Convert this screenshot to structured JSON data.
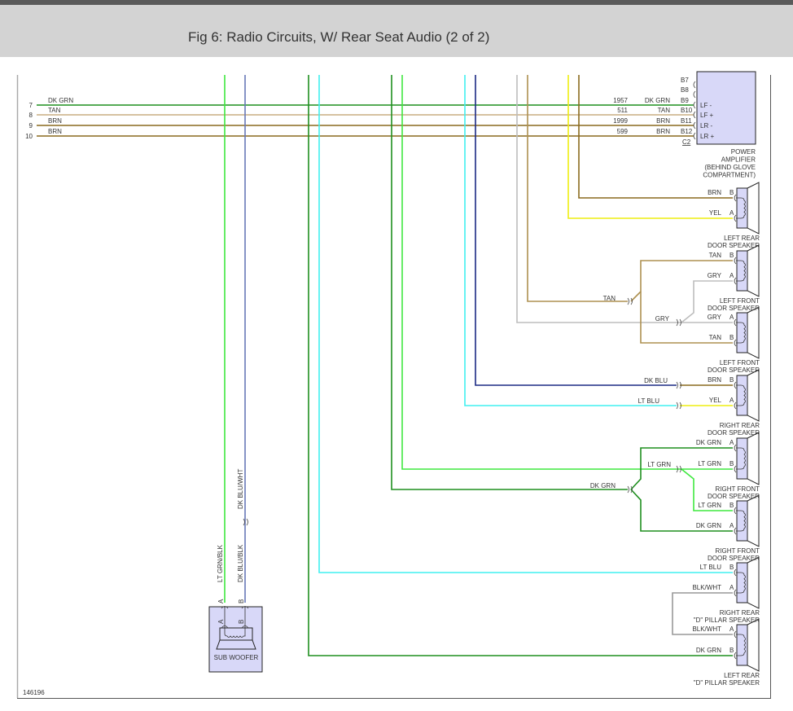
{
  "header": {
    "title": "Fig 6: Radio Circuits, W/ Rear Seat Audio (2 of 2)"
  },
  "figure_number": "146196",
  "colors": {
    "dk_grn": "#1f8f1f",
    "tan": "#c9ad82",
    "tan_dark": "#ad9050",
    "brn": "#8a6a1e",
    "lt_grn": "#3fe83f",
    "lt_blu": "#40f0f0",
    "dk_blu": "#1c2a84",
    "gry": "#bdbdbd",
    "yel": "#eeee10",
    "dk_blu_wht": "#6878b8",
    "blk_wht": "#999999",
    "component_fill": "#d8d8f8"
  },
  "harness": [
    {
      "pin": "7",
      "color": "DK GRN",
      "circuit": "1957",
      "amp_pin": "B9",
      "amp_label": "LF -"
    },
    {
      "pin": "8",
      "color": "TAN",
      "circuit": "511",
      "amp_pin": "B10",
      "amp_label": "LF +"
    },
    {
      "pin": "9",
      "color": "BRN",
      "circuit": "1999",
      "amp_pin": "B11",
      "amp_label": "LR -"
    },
    {
      "pin": "10",
      "color": "BRN",
      "circuit": "599",
      "amp_pin": "B12",
      "amp_label": "LR +"
    }
  ],
  "amplifier": {
    "unused_pins": [
      "B7",
      "B8"
    ],
    "connector": "C2",
    "name": [
      "POWER",
      "AMPLIFIER",
      "(BEHIND GLOVE",
      "COMPARTMENT)"
    ]
  },
  "speakers": [
    {
      "name": [
        "LEFT REAR",
        "DOOR SPEAKER"
      ],
      "pins": [
        {
          "pin": "B",
          "color": "BRN"
        },
        {
          "pin": "A",
          "color": "YEL"
        }
      ]
    },
    {
      "name": [
        "LEFT FRONT",
        "DOOR SPEAKER"
      ],
      "pins": [
        {
          "pin": "B",
          "color": "TAN"
        },
        {
          "pin": "A",
          "color": "GRY"
        }
      ]
    },
    {
      "name": [
        "LEFT FRONT",
        "DOOR SPEAKER"
      ],
      "pins": [
        {
          "pin": "A",
          "color": "GRY"
        },
        {
          "pin": "B",
          "color": "TAN"
        }
      ]
    },
    {
      "name": [
        "RIGHT REAR",
        "DOOR SPEAKER"
      ],
      "pins": [
        {
          "pin": "B",
          "color": "BRN"
        },
        {
          "pin": "A",
          "color": "YEL"
        }
      ]
    },
    {
      "name": [
        "RIGHT FRONT",
        "DOOR SPEAKER"
      ],
      "pins": [
        {
          "pin": "A",
          "color": "DK GRN"
        },
        {
          "pin": "B",
          "color": "LT GRN"
        }
      ]
    },
    {
      "name": [
        "RIGHT FRONT",
        "DOOR SPEAKER"
      ],
      "pins": [
        {
          "pin": "B",
          "color": "LT GRN"
        },
        {
          "pin": "A",
          "color": "DK GRN"
        }
      ]
    },
    {
      "name": [
        "RIGHT REAR",
        "\"D\" PILLAR SPEAKER"
      ],
      "pins": [
        {
          "pin": "B",
          "color": "LT BLU"
        },
        {
          "pin": "A",
          "color": "BLK/WHT"
        }
      ]
    },
    {
      "name": [
        "LEFT REAR",
        "\"D\" PILLAR SPEAKER"
      ],
      "pins": [
        {
          "pin": "A",
          "color": "BLK/WHT"
        },
        {
          "pin": "B",
          "color": "DK GRN"
        }
      ]
    }
  ],
  "splice_labels": {
    "tan": "TAN",
    "gry": "GRY",
    "dk_blu": "DK BLU",
    "lt_blu": "LT BLU",
    "lt_grn": "LT GRN",
    "dk_grn": "DK GRN"
  },
  "subwoofer": {
    "name": "SUB WOOFER",
    "pin_a": "A",
    "pin_b": "B",
    "wire_a": "LT GRN/BLK",
    "wire_b": "DK BLU/BLK",
    "wire_b_upper": "DK BLU/WHT"
  }
}
